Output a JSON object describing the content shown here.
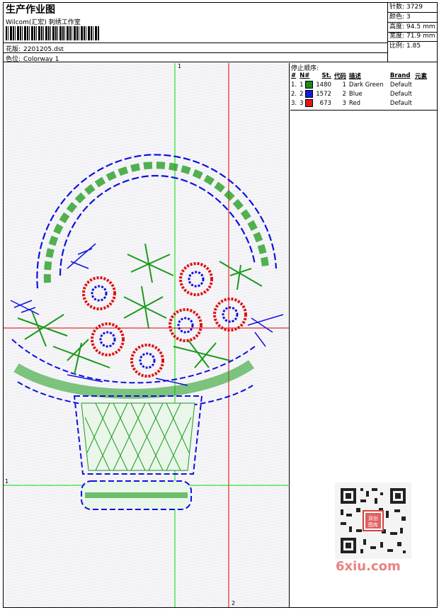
{
  "header": {
    "title": "生产作业图",
    "company": "Wilcom(汇宏) 刺绣工作室",
    "design_label": "花版:",
    "design_value": "2201205.dst",
    "colorway_label": "色位:",
    "colorway_value": "Colorway 1"
  },
  "stats": [
    {
      "label": "针数:",
      "value": "3729"
    },
    {
      "label": "颜色:",
      "value": "3"
    },
    {
      "label": "高度:",
      "value": "94.5 mm"
    },
    {
      "label": "宽度:",
      "value": "71.9 mm"
    },
    {
      "label": "比例:",
      "value": "1.85"
    }
  ],
  "stops": {
    "title": "停止顺序:",
    "headers": [
      "#",
      "N#",
      "St.",
      "代码",
      "描述",
      "Brand",
      "元素"
    ],
    "rows": [
      {
        "num": "1.",
        "n": "1",
        "color": "#1a8a1a",
        "st": "1480",
        "code": "1",
        "desc": "Dark Green",
        "brand": "Default"
      },
      {
        "num": "2.",
        "n": "2",
        "color": "#1818e0",
        "st": "1572",
        "code": "2",
        "desc": "Blue",
        "brand": "Default"
      },
      {
        "num": "3.",
        "n": "3",
        "color": "#e01818",
        "st": "673",
        "code": "3",
        "desc": "Red",
        "brand": "Default"
      }
    ]
  },
  "axes": {
    "v1_label": "1",
    "h1_label": "1",
    "v2_label": "2"
  },
  "colors": {
    "green": "#1a9a1a",
    "blue": "#1010e0",
    "red": "#e01010"
  },
  "watermark": "6xiu.com",
  "qr_stamp": "双创|图库"
}
